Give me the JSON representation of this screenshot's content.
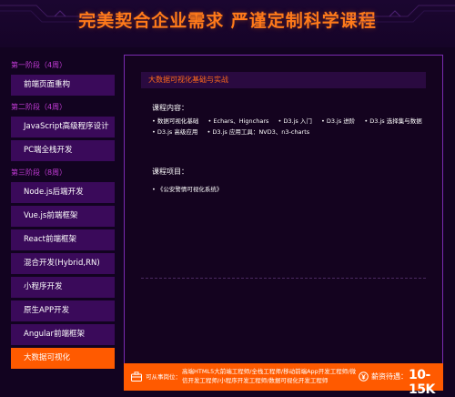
{
  "header": {
    "title": "完美契合企业需求 严谨定制科学课程"
  },
  "sidebar": {
    "groups": [
      {
        "label": "第一阶段（4周）",
        "items": [
          "前端页面重构"
        ]
      },
      {
        "label": "第二阶段（4周）",
        "items": [
          "JavaScript高级程序设计",
          "PC端全栈开发"
        ]
      },
      {
        "label": "第三阶段（8周）",
        "items": [
          "Node.js后端开发",
          "Vue.js前端框架",
          "React前端框架",
          "混合开发(Hybrid,RN)",
          "小程序开发",
          "原生APP开发",
          "Angular前端框架",
          "大数据可视化"
        ]
      }
    ],
    "active_item": "大数据可视化"
  },
  "main": {
    "section_title": "大数据可视化基础与实战",
    "content_label": "课程内容：",
    "topics": [
      "• 数据可视化基础",
      "• Echars、Hignchars",
      "• D3.js 入门",
      "• D3.js 进阶",
      "• D3.js 选择集与数据",
      "• D3.js 高级应用",
      "• D3.js 应用工具：NVD3、n3-charts"
    ],
    "project_label": "课程项目：",
    "projects": [
      "• 《公安警情可视化系统》"
    ]
  },
  "bottom": {
    "job_label": "可从事岗位：",
    "jobs": "高端HTML5大前端工程师/全栈工程师/移动前端App开发工程师/微信开发工程师/小程序开发工程师/数据可视化开发工程师",
    "salary_label": "薪资待遇：",
    "salary_value": "10-15K"
  },
  "colors": {
    "accent": "#ff5a00",
    "title": "#ff7a1a",
    "nav_bg": "#3a0a5a",
    "stage_label": "#c23bd6",
    "panel_border": "#7a2bb0",
    "page_bg": "#120320"
  },
  "icons": {
    "job": "briefcase-icon",
    "salary": "money-icon"
  }
}
